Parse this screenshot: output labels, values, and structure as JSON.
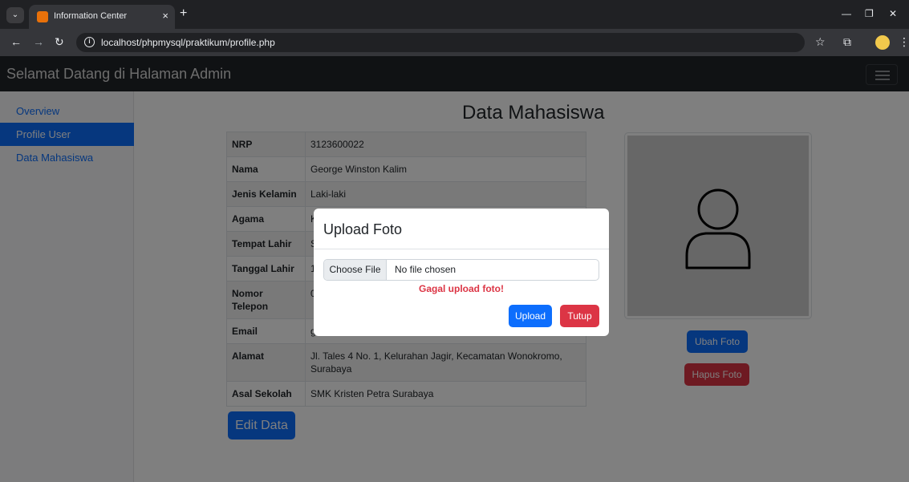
{
  "browser": {
    "tab_title": "Information Center",
    "tab_close": "×",
    "new_tab": "+",
    "url": "localhost/phpmysql/praktikum/profile.php",
    "favicon_letter": "■"
  },
  "navbar": {
    "brand": "Selamat Datang di Halaman Admin"
  },
  "sidebar": {
    "items": [
      {
        "label": "Overview"
      },
      {
        "label": "Profile User"
      },
      {
        "label": "Data Mahasiswa"
      }
    ]
  },
  "main": {
    "title": "Data Mahasiswa",
    "rows": [
      {
        "label": "NRP",
        "value": "3123600022"
      },
      {
        "label": "Nama",
        "value": "George Winston Kalim"
      },
      {
        "label": "Jenis Kelamin",
        "value": "Laki-laki"
      },
      {
        "label": "Agama",
        "value": "K"
      },
      {
        "label": "Tempat Lahir",
        "value": "S"
      },
      {
        "label": "Tanggal Lahir",
        "value": "1"
      },
      {
        "label": "Nomor Telepon",
        "value": "0"
      },
      {
        "label": "Email",
        "value": "g"
      },
      {
        "label": "Alamat",
        "value": "Jl. Tales 4 No. 1, Kelurahan Jagir, Kecamatan Wonokromo, Surabaya"
      },
      {
        "label": "Asal Sekolah",
        "value": "SMK Kristen Petra Surabaya"
      }
    ],
    "edit_button": "Edit Data",
    "ubah_button": "Ubah Foto",
    "hapus_button": "Hapus Foto"
  },
  "modal": {
    "title": "Upload Foto",
    "choose_file": "Choose File",
    "file_status": "No file chosen",
    "error": "Gagal upload foto!",
    "upload_button": "Upload",
    "close_button": "Tutup"
  },
  "colors": {
    "primary": "#0d6efd",
    "danger": "#dc3545",
    "navbar": "#212529"
  }
}
